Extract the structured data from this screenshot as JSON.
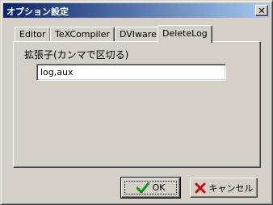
{
  "window": {
    "title": "オプション設定",
    "close_glyph": "✕"
  },
  "tabs": [
    {
      "label": "Editor",
      "active": false
    },
    {
      "label": "TeXCompiler",
      "active": false
    },
    {
      "label": "DVIware",
      "active": false
    },
    {
      "label": "DeleteLog",
      "active": true
    }
  ],
  "delete_log": {
    "field_label": "拡張子(カンマで区切る)",
    "extensions_value": "log,aux"
  },
  "buttons": {
    "ok_label": "OK",
    "cancel_label": "キャンセル"
  },
  "icons": {
    "ok": "check-icon",
    "cancel": "x-mark-icon"
  },
  "colors": {
    "title_bar_start": "#0a246a",
    "title_bar_end": "#a6caf0",
    "face": "#d4d0c8",
    "ok_check": "#1a8f1a",
    "cancel_x": "#c01010"
  }
}
